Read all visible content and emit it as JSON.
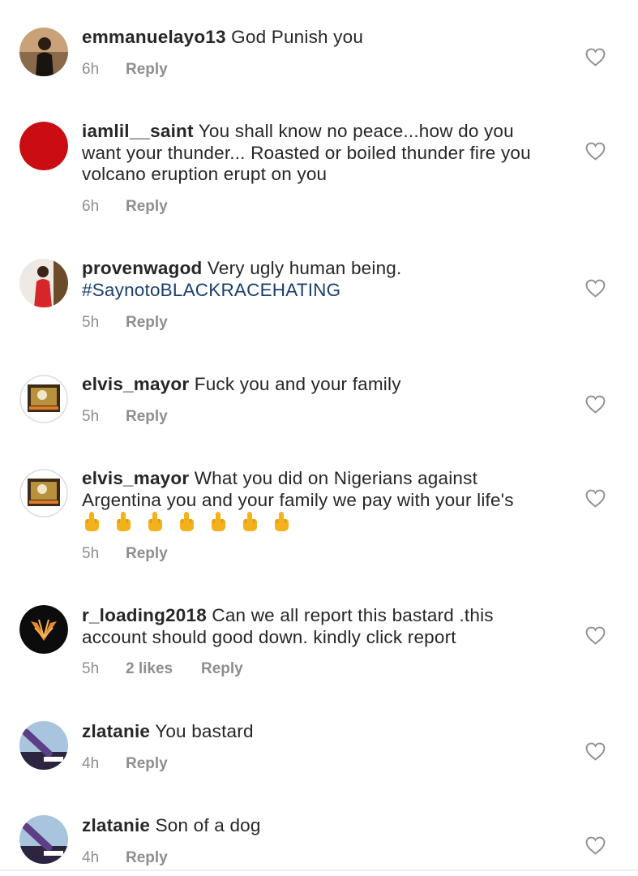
{
  "comments": [
    {
      "username": "emmanuelayo13",
      "text": "God Punish you",
      "time": "6h",
      "reply": "Reply",
      "likes": ""
    },
    {
      "username": "iamlil__saint",
      "text": "You shall know no peace...how do you want your thunder... Roasted or boiled thunder fire you volcano eruption erupt on you",
      "time": "6h",
      "reply": "Reply",
      "likes": ""
    },
    {
      "username": "provenwagod",
      "text": "Very ugly human being.",
      "hashtag": "#SaynotoBLACKRACEHATING",
      "time": "5h",
      "reply": "Reply",
      "likes": ""
    },
    {
      "username": "elvis_mayor",
      "text": "Fuck you and your family",
      "time": "5h",
      "reply": "Reply",
      "likes": ""
    },
    {
      "username": "elvis_mayor",
      "text": "What you did on Nigerians against Argentina you and your family we pay with your life's",
      "emoji": "🖕🖕🖕🖕🖕🖕🖕",
      "time": "5h",
      "reply": "Reply",
      "likes": ""
    },
    {
      "username": "r_loading2018",
      "text": "Can we all report this bastard .this account should good down. kindly click report",
      "time": "5h",
      "likes": "2 likes",
      "reply": "Reply"
    },
    {
      "username": "zlatanie",
      "text": "You bastard",
      "time": "4h",
      "reply": "Reply",
      "likes": ""
    },
    {
      "username": "zlatanie",
      "text": "Son of a dog",
      "time": "4h",
      "reply": "Reply",
      "likes": ""
    }
  ],
  "icons": {
    "like": "heart-outline-icon",
    "gesture": "middle-finger-emoji"
  },
  "colors": {
    "username": "#262626",
    "meta": "#8e8e8e",
    "hashtag": "#1b3f6e",
    "heart": "#8e8e8e",
    "emoji": "#f3b21b"
  }
}
